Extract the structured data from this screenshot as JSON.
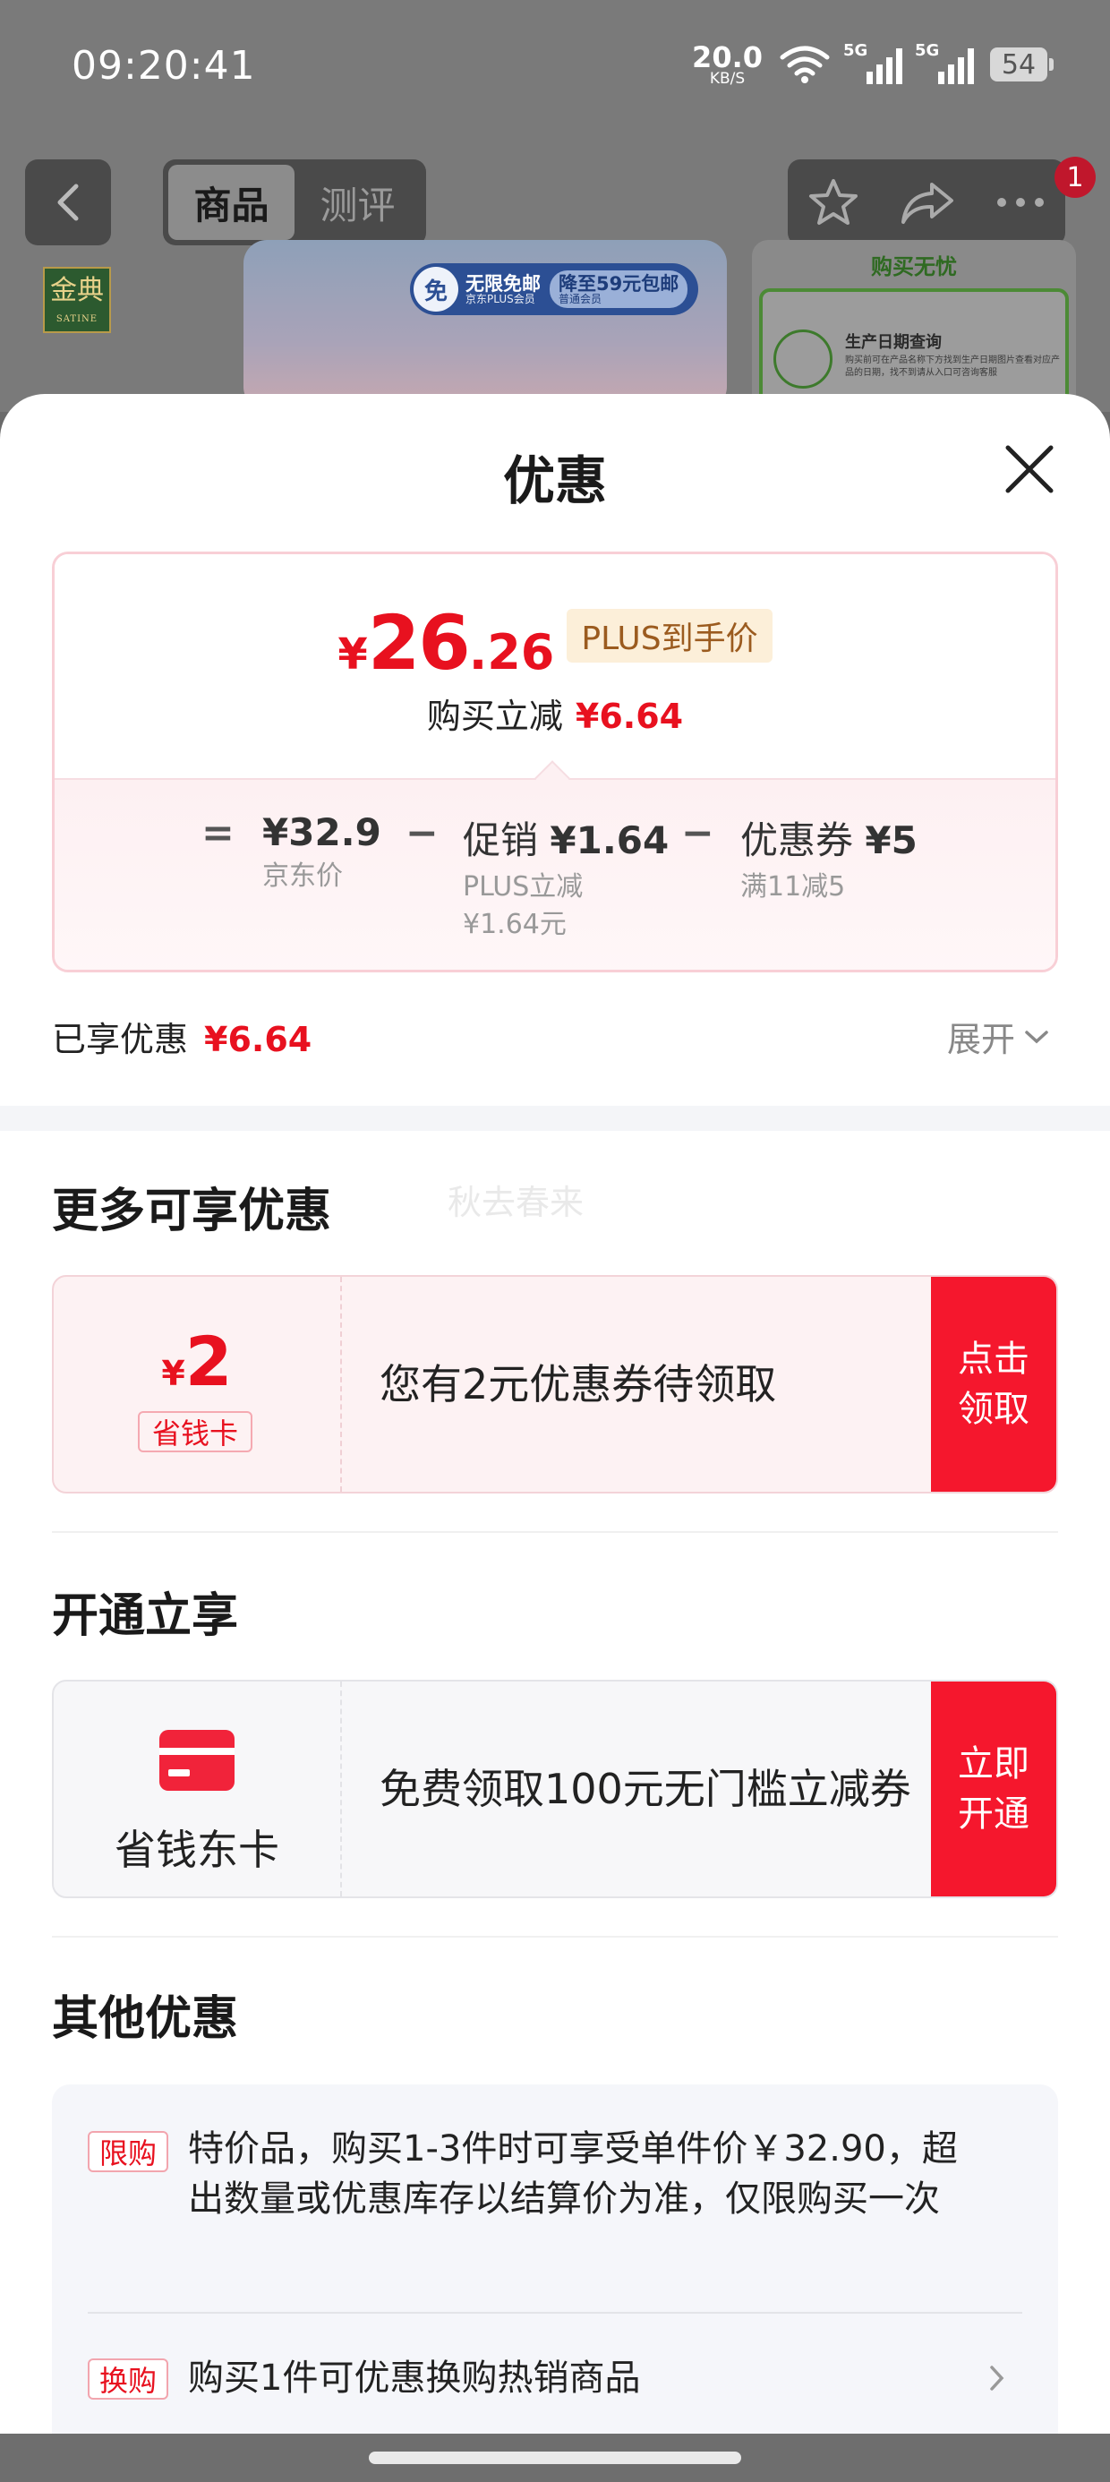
{
  "status_bar": {
    "time": "09:20:41",
    "net_speed_value": "20.0",
    "net_speed_unit": "KB/S",
    "signal1_label": "5G",
    "signal2_label": "5G",
    "battery": "54"
  },
  "nav": {
    "tabs": [
      "商品",
      "测评"
    ],
    "active_tab": "商品",
    "badge_count": "1"
  },
  "background": {
    "brand_logo_cn": "金典",
    "brand_logo_en": "SATINE",
    "banner_circle": "免",
    "banner_left_title": "无限免邮",
    "banner_left_sub": "京东PLUS会员",
    "banner_right_title": "降至59元包邮",
    "banner_right_sub": "普通会员",
    "side_card_title": "购买无忧",
    "side_card_item_title": "生产日期查询",
    "side_card_item_sub": "购买前可在产品名称下方找到生产日期图片查看对应产品的日期，找不到请从入口可咨询客服"
  },
  "sheet": {
    "title": "优惠",
    "price": {
      "symbol": "¥",
      "integer": "26",
      "decimal": ".26",
      "plus_tag": "PLUS到手价",
      "save_label": "购买立减",
      "save_amount": "¥6.64"
    },
    "formula": {
      "eq": "=",
      "minus": "−",
      "jd_price": "¥32.9",
      "jd_price_label": "京东价",
      "promo_label": "促销",
      "promo_amount": "¥1.64",
      "promo_sub1": "PLUS立减",
      "promo_sub2": "¥1.64元",
      "coupon_label": "优惠券",
      "coupon_amount": "¥5",
      "coupon_sub": "满11减5"
    },
    "enjoyed_label": "已享优惠",
    "enjoyed_amount": "¥6.64",
    "expand_label": "展开",
    "more_title": "更多可享优惠",
    "watermark": "秋去春来",
    "coupon1": {
      "symbol": "¥",
      "amount": "2",
      "tag": "省钱卡",
      "text": "您有2元优惠券待领取",
      "button_line1": "点击",
      "button_line2": "领取"
    },
    "open_title": "开通立享",
    "coupon2": {
      "label": "省钱东卡",
      "text": "免费领取100元无门槛立减券",
      "button_line1": "立即",
      "button_line2": "开通"
    },
    "other_title": "其他优惠",
    "other_items": [
      {
        "tag": "限购",
        "text": "特价品，购买1-3件时可享受单件价￥32.90，超出数量或优惠库存以结算价为准，仅限购买一次"
      },
      {
        "tag": "换购",
        "text": "购买1件可优惠换购热销商品"
      }
    ]
  },
  "colors": {
    "accent_red": "#e8111f",
    "button_red": "#f5172d",
    "plus_tag_bg": "#fcefd9",
    "plus_tag_text": "#9b5b1f"
  }
}
